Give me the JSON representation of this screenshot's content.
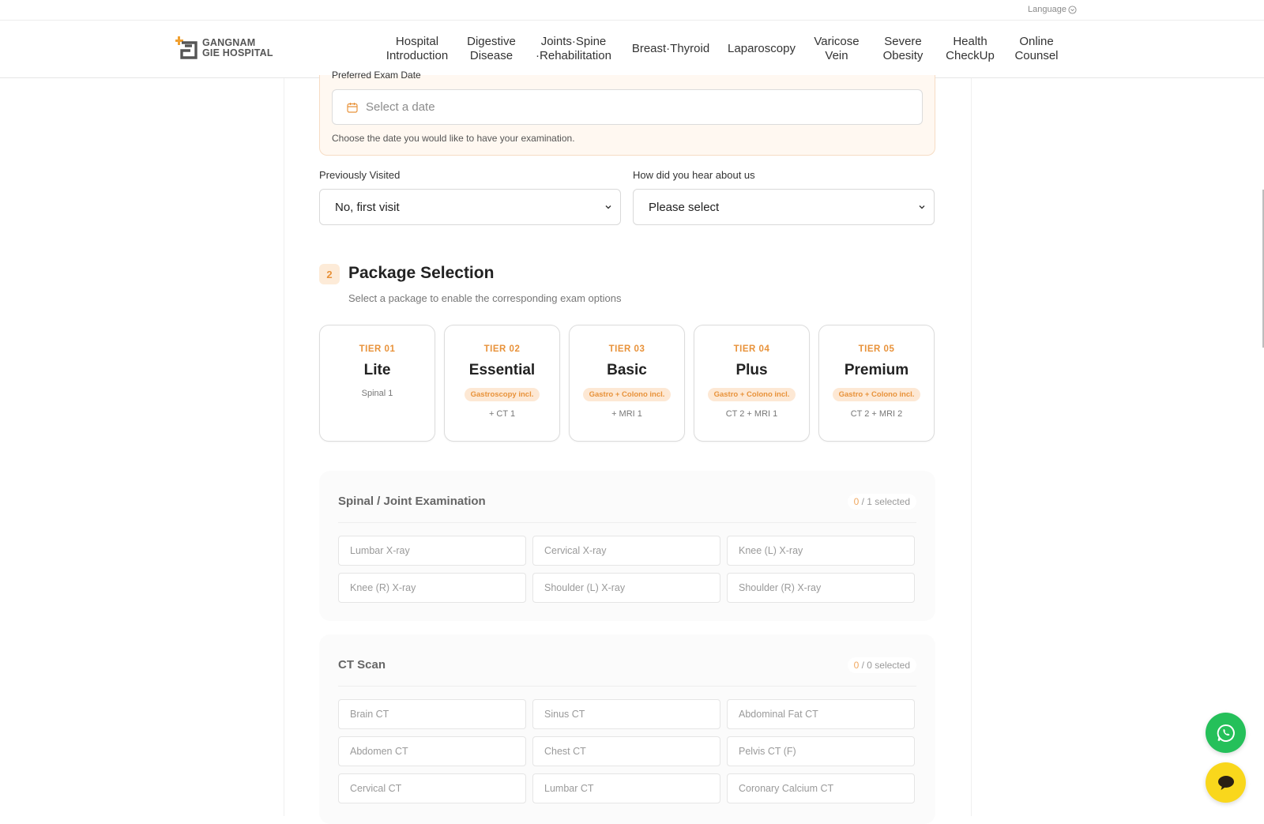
{
  "topbar": {
    "language_label": "Language",
    "language_icon": "chevron-circle-down-icon"
  },
  "logo": {
    "line1": "GANGNAM",
    "line2": "GIE HOSPITAL",
    "accent": "#f0a030",
    "mark_color": "#555555"
  },
  "nav": [
    {
      "label": "Hospital\nIntroduction"
    },
    {
      "label": "Digestive\nDisease"
    },
    {
      "label": "Joints·Spine\n·Rehabilitation"
    },
    {
      "label": "Breast·Thyroid"
    },
    {
      "label": "Laparoscopy"
    },
    {
      "label": "Varicose\nVein"
    },
    {
      "label": "Severe\nObesity"
    },
    {
      "label": "Health\nCheckUp"
    },
    {
      "label": "Online\nCounsel"
    }
  ],
  "exam_date": {
    "label": "Preferred Exam Date",
    "placeholder": "Select a date",
    "icon": "calendar-icon",
    "help": "Choose the date you would like to have your examination."
  },
  "previously_visited": {
    "label": "Previously Visited",
    "value": "No, first visit"
  },
  "referral": {
    "label": "How did you hear about us",
    "value": "Please select"
  },
  "package": {
    "step": "2",
    "title": "Package Selection",
    "subtitle": "Select a package to enable the corresponding exam options",
    "tiers": [
      {
        "code": "TIER 01",
        "name": "Lite",
        "badge": "",
        "extra": "Spinal 1"
      },
      {
        "code": "TIER 02",
        "name": "Essential",
        "badge": "Gastroscopy incl.",
        "extra": "+ CT 1"
      },
      {
        "code": "TIER 03",
        "name": "Basic",
        "badge": "Gastro + Colono incl.",
        "extra": "+ MRI 1"
      },
      {
        "code": "TIER 04",
        "name": "Plus",
        "badge": "Gastro + Colono incl.",
        "extra": "CT 2 + MRI 1"
      },
      {
        "code": "TIER 05",
        "name": "Premium",
        "badge": "Gastro + Colono incl.",
        "extra": "CT 2 + MRI 2"
      }
    ]
  },
  "groups": {
    "spinal": {
      "title": "Spinal / Joint Examination",
      "count_selected": "0",
      "count_rest": " / 1 selected",
      "options": [
        "Lumbar X-ray",
        "Cervical X-ray",
        "Knee (L) X-ray",
        "Knee (R) X-ray",
        "Shoulder (L) X-ray",
        "Shoulder (R) X-ray"
      ]
    },
    "ct": {
      "title": "CT Scan",
      "count_selected": "0",
      "count_rest": " / 0 selected",
      "options": [
        "Brain CT",
        "Sinus CT",
        "Abdominal Fat CT",
        "Abdomen CT",
        "Chest CT",
        "Pelvis CT (F)",
        "Cervical CT",
        "Lumbar CT",
        "Coronary Calcium CT"
      ]
    }
  },
  "fab": {
    "whatsapp_icon": "whatsapp-icon",
    "chat_icon": "chat-bubble-icon",
    "whatsapp_color": "#25c05a",
    "chat_color": "#f9d71c"
  },
  "colors": {
    "accent": "#e8923a",
    "accent_bg": "#fff8f1"
  }
}
